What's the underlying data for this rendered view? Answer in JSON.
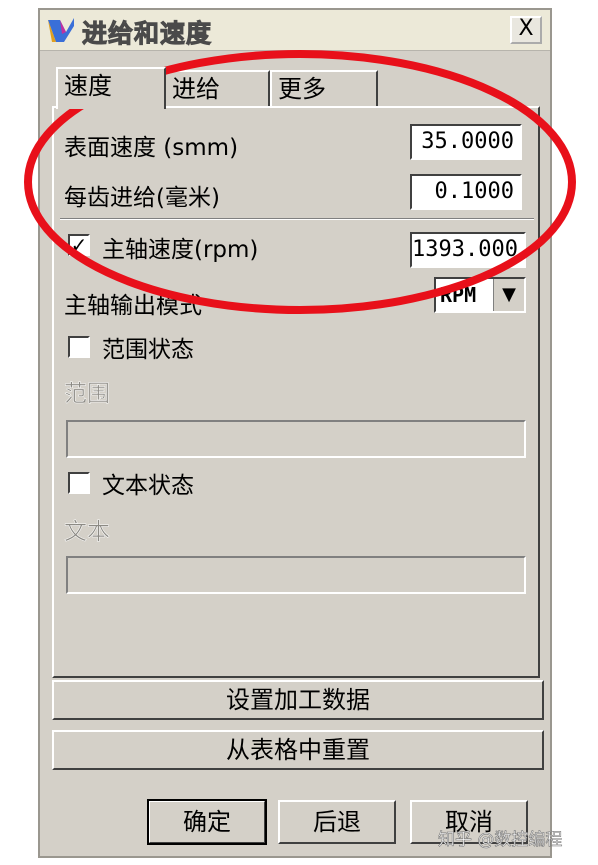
{
  "window": {
    "title": "进给和速度",
    "close_glyph": "X"
  },
  "tabs": [
    {
      "label": "速度",
      "active": true
    },
    {
      "label": "进给",
      "active": false
    },
    {
      "label": "更多",
      "active": false
    }
  ],
  "speed": {
    "surface_speed_label": "表面速度 (smm)",
    "surface_speed_value": "35.0000",
    "feed_per_tooth_label": "每齿进给(毫米)",
    "feed_per_tooth_value": "0.1000",
    "spindle_speed_checked": true,
    "spindle_speed_label": "主轴速度(rpm)",
    "spindle_speed_value": "1393.000",
    "spindle_output_mode_label": "主轴输出模式",
    "spindle_output_mode_value": "RPM"
  },
  "range": {
    "checkbox_label": "范围状态",
    "checked": false,
    "field_label": "范围",
    "value": ""
  },
  "text": {
    "checkbox_label": "文本状态",
    "checked": false,
    "field_label": "文本",
    "value": ""
  },
  "actions": {
    "set_machining_data": "设置加工数据",
    "reset_from_table": "从表格中重置"
  },
  "buttons": {
    "ok": "确定",
    "back": "后退",
    "cancel": "取消"
  },
  "colors": {
    "dialog_bg": "#d4d0c8",
    "annotation_ellipse": "#e8101a"
  },
  "icons": {
    "app": "app-logo-icon",
    "close": "close-icon",
    "check": "check-mark-icon",
    "dropdown": "dropdown-arrow-icon"
  },
  "watermark": "知乎 @数控编程"
}
